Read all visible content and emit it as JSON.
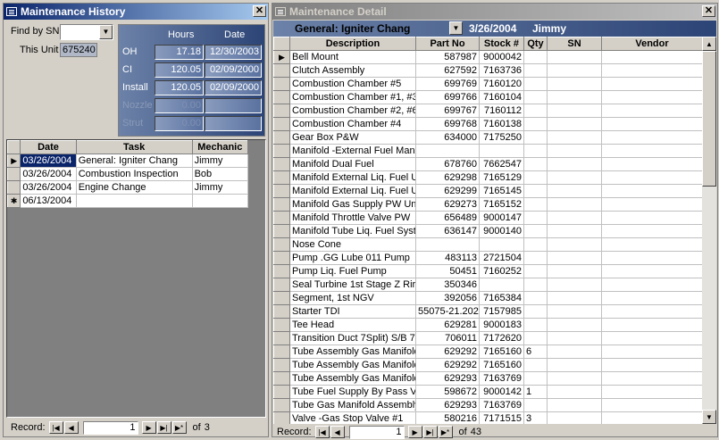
{
  "history": {
    "title": "Maintenance History",
    "find_by_sn_label": "Find by SN",
    "find_by_sn_value": "",
    "this_unit_label": "This Unit",
    "this_unit_value": "675240",
    "hours_header": "Hours",
    "date_header": "Date",
    "rows": [
      {
        "label": "OH",
        "hours": "17.18",
        "date": "12/30/2003",
        "enabled": true
      },
      {
        "label": "CI",
        "hours": "120.05",
        "date": "02/09/2000",
        "enabled": true
      },
      {
        "label": "Install",
        "hours": "120.05",
        "date": "02/09/2000",
        "enabled": true
      },
      {
        "label": "Nozzle",
        "hours": "0.00",
        "date": "",
        "enabled": false
      },
      {
        "label": "Strut",
        "hours": "0.00",
        "date": "",
        "enabled": false
      }
    ],
    "grid": {
      "columns": [
        "Date",
        "Task",
        "Mechanic"
      ],
      "rows": [
        [
          "03/26/2004",
          "General: Igniter Chang",
          "Jimmy"
        ],
        [
          "03/26/2004",
          "Combustion Inspection",
          "Bob"
        ],
        [
          "03/26/2004",
          "Engine Change",
          "Jimmy"
        ],
        [
          "06/13/2004",
          "",
          ""
        ]
      ]
    },
    "nav": {
      "label": "Record:",
      "current": "1",
      "of_label": "of",
      "total": "3"
    }
  },
  "detail": {
    "title": "Maintenance Detail",
    "header_task": "General: Igniter Chang",
    "header_date": "3/26/2004",
    "header_mechanic": "Jimmy",
    "columns": [
      "Description",
      "Part No",
      "Stock #",
      "Qty",
      "SN",
      "Vendor"
    ],
    "rows": [
      [
        "Bell Mount",
        "587987",
        "9000042",
        "",
        "",
        ""
      ],
      [
        "Clutch Assembly",
        "627592",
        "7163736",
        "",
        "",
        ""
      ],
      [
        "Combustion Chamber #5",
        "699769",
        "7160120",
        "",
        "",
        ""
      ],
      [
        "Combustion Chamber #1, #3",
        "699766",
        "7160104",
        "",
        "",
        ""
      ],
      [
        "Combustion Chamber #2, #6",
        "699767",
        "7160112",
        "",
        "",
        ""
      ],
      [
        "Combustion Chamber #4",
        "699768",
        "7160138",
        "",
        "",
        ""
      ],
      [
        "Gear Box P&W",
        "634000",
        "7175250",
        "",
        "",
        ""
      ],
      [
        "Manifold -External Fuel Manif",
        "",
        "",
        "",
        "",
        ""
      ],
      [
        "Manifold Dual Fuel",
        "678760",
        "7662547",
        "",
        "",
        ""
      ],
      [
        "Manifold External Liq. Fuel U",
        "629298",
        "7165129",
        "",
        "",
        ""
      ],
      [
        "Manifold External Liq. Fuel U",
        "629299",
        "7165145",
        "",
        "",
        ""
      ],
      [
        "Manifold Gas Supply PW Un",
        "629273",
        "7165152",
        "",
        "",
        ""
      ],
      [
        "Manifold Throttle Valve PW",
        "656489",
        "9000147",
        "",
        "",
        ""
      ],
      [
        "Manifold Tube Liq. Fuel Syst",
        "636147",
        "9000140",
        "",
        "",
        ""
      ],
      [
        "Nose Cone",
        "",
        "",
        "",
        "",
        ""
      ],
      [
        "Pump .GG Lube 011 Pump",
        "483113",
        "2721504",
        "",
        "",
        ""
      ],
      [
        "Pump Liq. Fuel Pump",
        "50451",
        "7160252",
        "",
        "",
        ""
      ],
      [
        "Seal Turbine 1st Stage Z Rir",
        "350346",
        "",
        "",
        "",
        ""
      ],
      [
        "Segment, 1st NGV",
        "392056",
        "7165384",
        "",
        "",
        ""
      ],
      [
        "Starter TDI",
        "55075-21.202",
        "7157985",
        "",
        "",
        ""
      ],
      [
        "Tee Head",
        "629281",
        "9000183",
        "",
        "",
        ""
      ],
      [
        "Transition Duct 7Split) S/B 7",
        "706011",
        "7172620",
        "",
        "",
        ""
      ],
      [
        "Tube Assembly Gas Manifold",
        "629292",
        "7165160",
        "6",
        "",
        ""
      ],
      [
        "Tube Assembly Gas Manifold",
        "629292",
        "7165160",
        "",
        "",
        ""
      ],
      [
        "Tube Assembly Gas Manifold",
        "629293",
        "7163769",
        "",
        "",
        ""
      ],
      [
        "Tube Fuel Supply By Pass V",
        "598672",
        "9000142",
        "1",
        "",
        ""
      ],
      [
        "Tube Gas Manifold Assembly",
        "629293",
        "7163769",
        "",
        "",
        ""
      ],
      [
        "Valve -Gas Stop Valve #1",
        "580216",
        "7171515",
        "3",
        "",
        ""
      ]
    ],
    "nav": {
      "label": "Record:",
      "current": "1",
      "of_label": "of",
      "total": "43"
    }
  },
  "icons": {
    "close": "close-icon",
    "window": "form-icon",
    "dropdown": "chevron-down-icon"
  }
}
